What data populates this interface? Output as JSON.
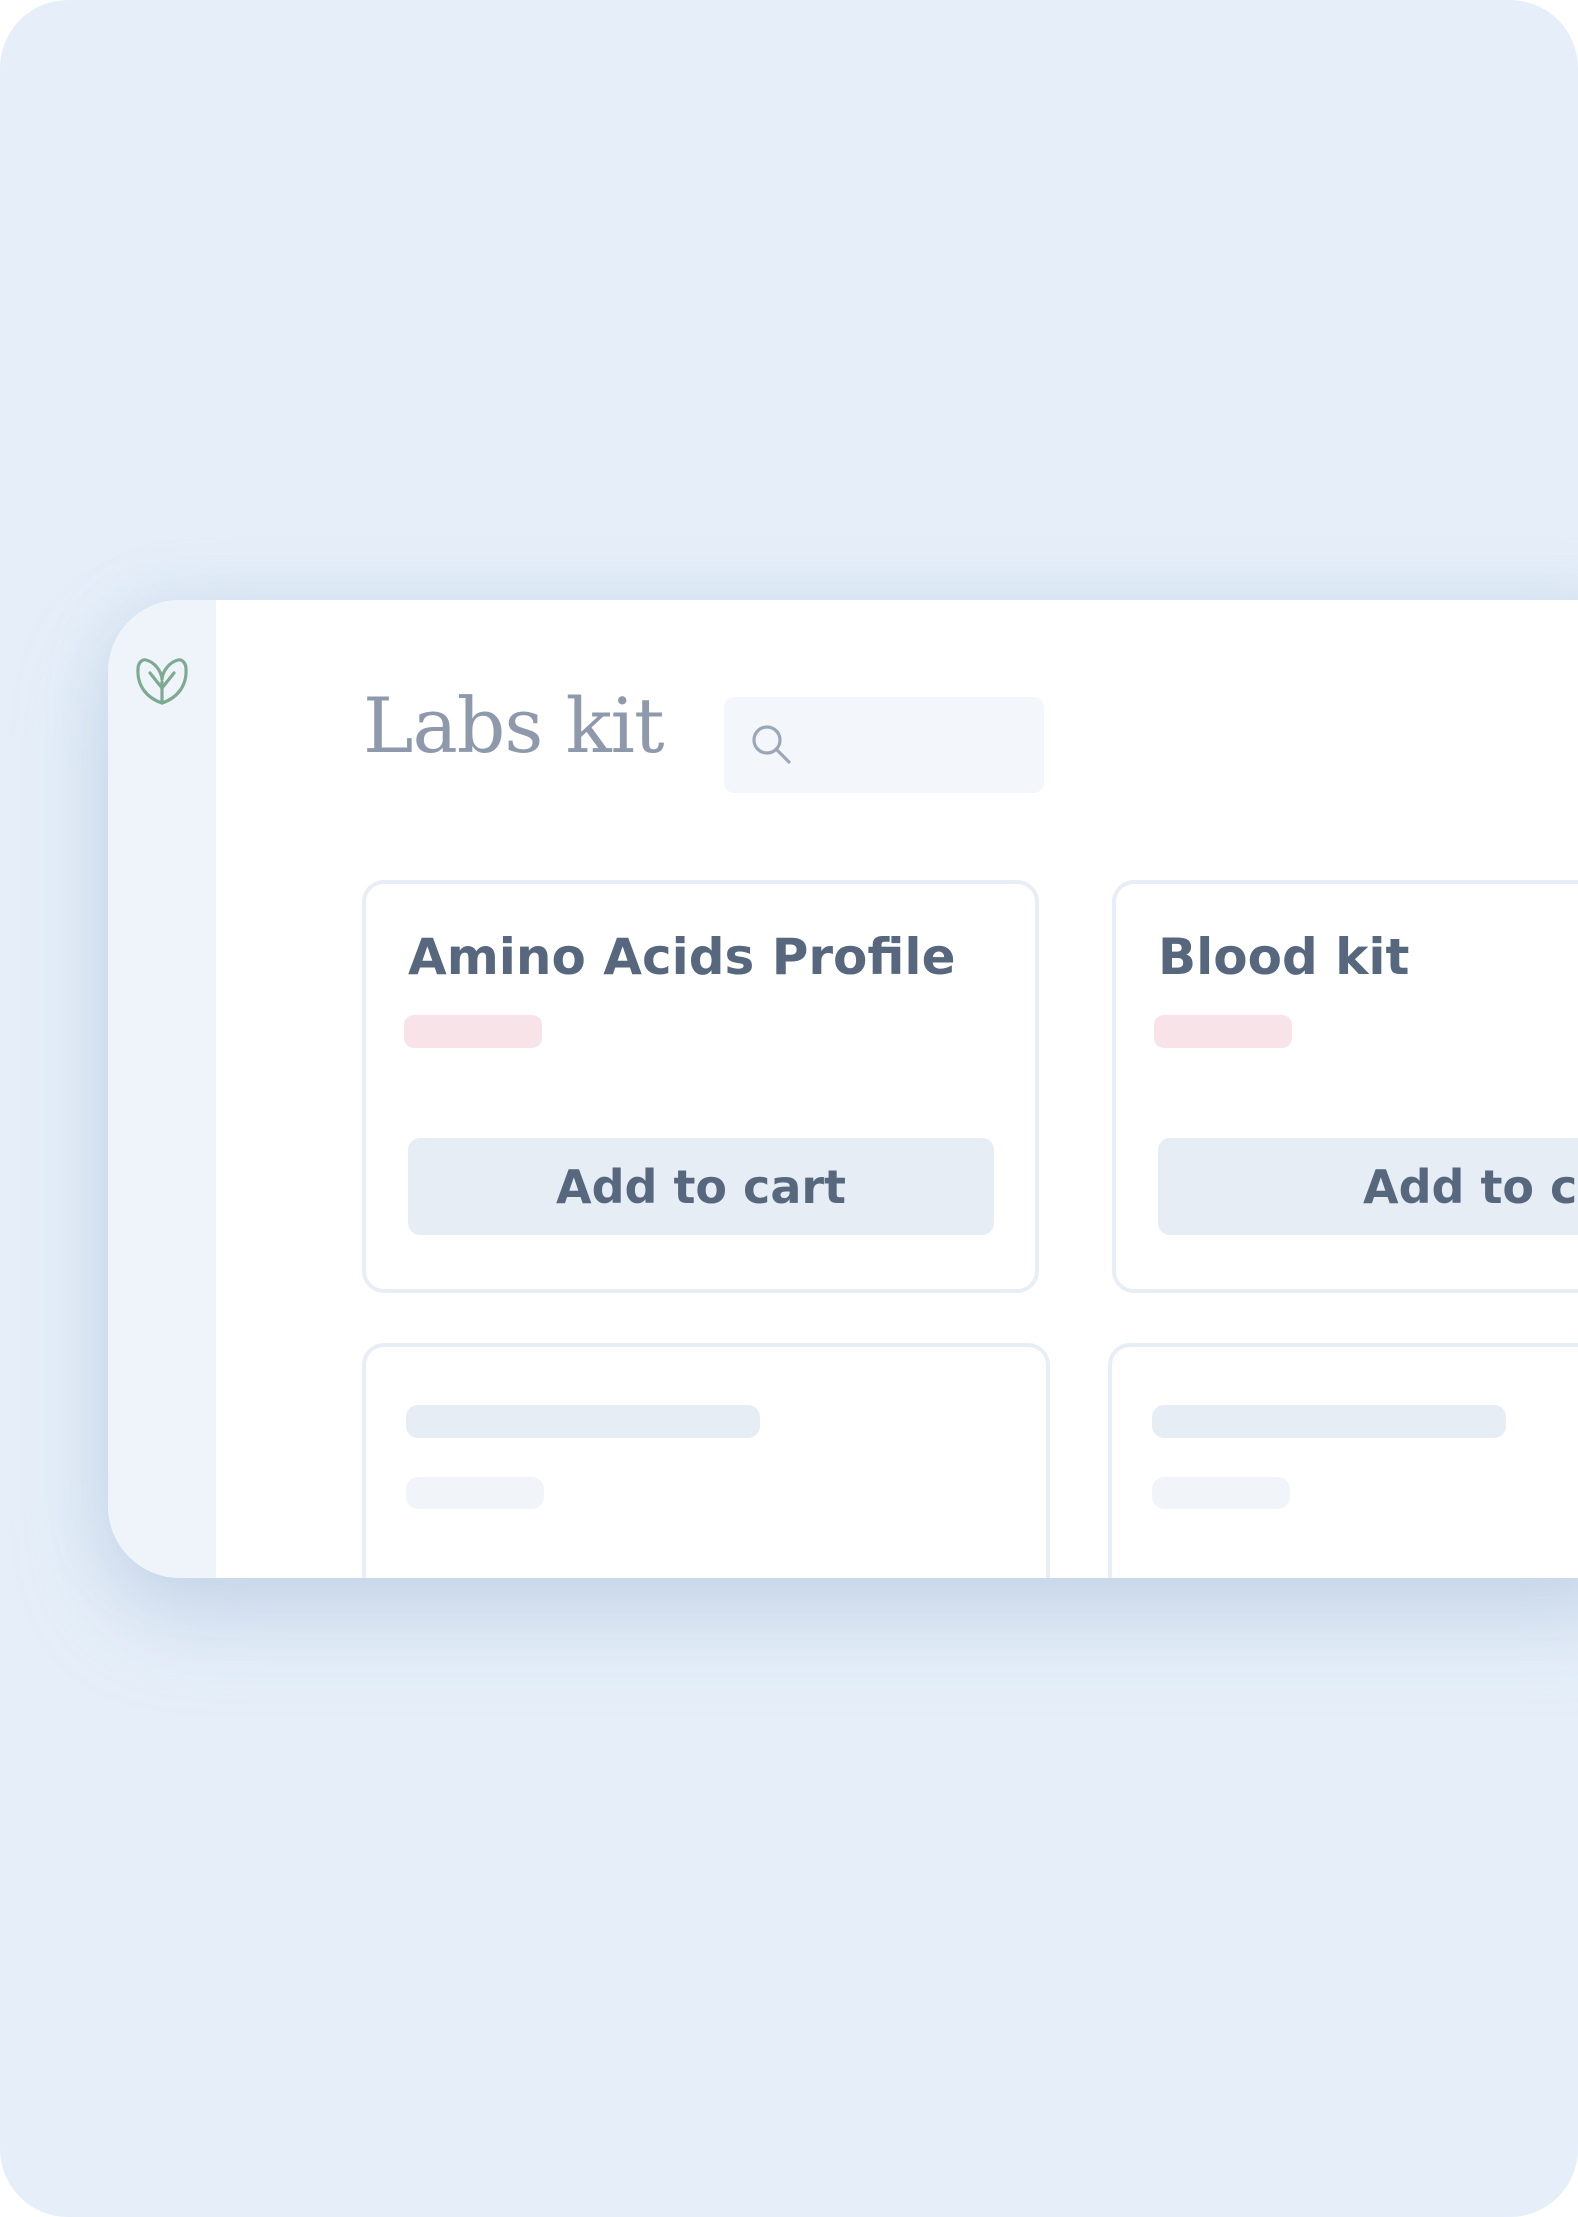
{
  "app": {
    "title": "Labs kit",
    "logo_icon": "leaf-heart-icon"
  },
  "search": {
    "icon": "search-icon",
    "placeholder": ""
  },
  "products": [
    {
      "name": "Amino Acids Profile",
      "cta_label": "Add to cart"
    },
    {
      "name": "Blood kit",
      "cta_label": "Add to cart"
    }
  ],
  "colors": {
    "background": "#e6eff9",
    "sidebar": "#eff4fb",
    "brand_green": "#7faa92",
    "title_text": "#8e9aab",
    "card_text": "#56677e",
    "button_bg": "#e6edf4",
    "badge_pink": "#f8e3e9"
  }
}
